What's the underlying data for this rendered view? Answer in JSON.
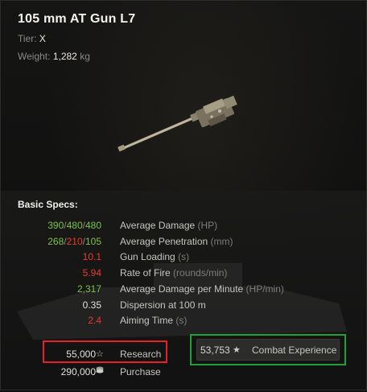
{
  "header": {
    "title": "105 mm AT Gun L7",
    "tier_label": "Tier:",
    "tier_value": "X",
    "weight_label": "Weight:",
    "weight_value": "1,282",
    "weight_unit": "kg"
  },
  "specs": {
    "title": "Basic Specs:",
    "rows": [
      {
        "parts": [
          {
            "text": "390",
            "color": "green"
          },
          {
            "text": "/",
            "color": "sep"
          },
          {
            "text": "480",
            "color": "green"
          },
          {
            "text": "/",
            "color": "sep"
          },
          {
            "text": "480",
            "color": "green"
          }
        ],
        "name": "Average Damage",
        "unit": "(HP)"
      },
      {
        "parts": [
          {
            "text": "268",
            "color": "green"
          },
          {
            "text": "/",
            "color": "sep"
          },
          {
            "text": "210",
            "color": "red"
          },
          {
            "text": "/",
            "color": "sep"
          },
          {
            "text": "105",
            "color": "green"
          }
        ],
        "name": "Average Penetration",
        "unit": "(mm)"
      },
      {
        "parts": [
          {
            "text": "10.1",
            "color": "red"
          }
        ],
        "name": "Gun Loading",
        "unit": "(s)"
      },
      {
        "parts": [
          {
            "text": "5.94",
            "color": "red"
          }
        ],
        "name": "Rate of Fire",
        "unit": "(rounds/min)"
      },
      {
        "parts": [
          {
            "text": "2,317",
            "color": "green"
          }
        ],
        "name": "Average Damage per Minute",
        "unit": "(HP/min)"
      },
      {
        "parts": [
          {
            "text": "0.35",
            "color": "white"
          }
        ],
        "name": "Dispersion at 100 m",
        "unit": ""
      },
      {
        "parts": [
          {
            "text": "2.4",
            "color": "red"
          }
        ],
        "name": "Aiming Time",
        "unit": "(s)"
      }
    ]
  },
  "costs": {
    "research_value": "55,000",
    "research_label": "Research",
    "research_icon": "xp-star-icon",
    "purchase_value": "290,000",
    "purchase_label": "Purchase",
    "purchase_icon": "credits-icon"
  },
  "combat_xp": {
    "value": "53,753",
    "label": "Combat Experience",
    "icon": "xp-star-icon"
  },
  "colors": {
    "green": "#7ec14a",
    "red": "#ee3a2b",
    "white": "#e2e0da",
    "sep": "#8a8985",
    "highlight_red": "#e8202a",
    "highlight_green": "#21a03a"
  }
}
